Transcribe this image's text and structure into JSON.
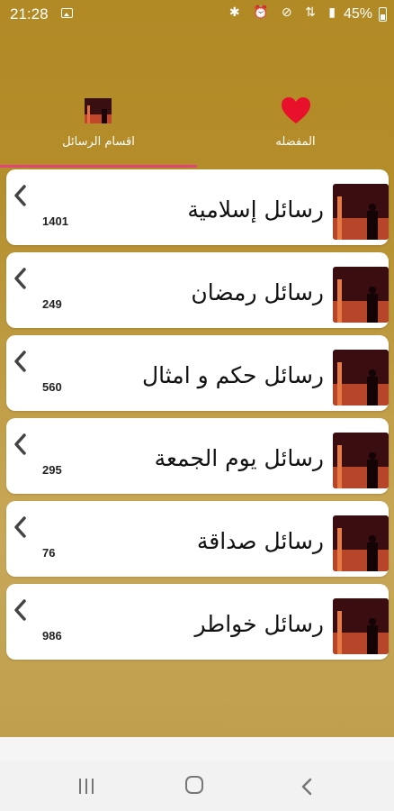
{
  "status_bar": {
    "time": "21:28",
    "icons": "✱ ⏰ ⊘ ⇅ ▮",
    "battery": "45%"
  },
  "tabs": [
    {
      "label": "اقسام الرسائل",
      "icon": "category-image-icon",
      "selected": true
    },
    {
      "label": "المفضله",
      "icon": "heart-icon",
      "selected": false
    }
  ],
  "colors": {
    "background": "#b48d2a",
    "tab_indicator": "#e0467a",
    "heart": "#e8102a",
    "card": "#ffffff"
  },
  "categories": [
    {
      "title": "رسائل إسلامية",
      "count": "1401"
    },
    {
      "title": "رسائل رمضان",
      "count": "249"
    },
    {
      "title": "رسائل حكم و امثال",
      "count": "560"
    },
    {
      "title": "رسائل يوم الجمعة",
      "count": "295"
    },
    {
      "title": "رسائل صداقة",
      "count": "76"
    },
    {
      "title": "رسائل خواطر",
      "count": "986"
    }
  ],
  "nav_bar": {
    "recents": "recents-icon",
    "home": "home-icon",
    "back": "back-icon"
  }
}
